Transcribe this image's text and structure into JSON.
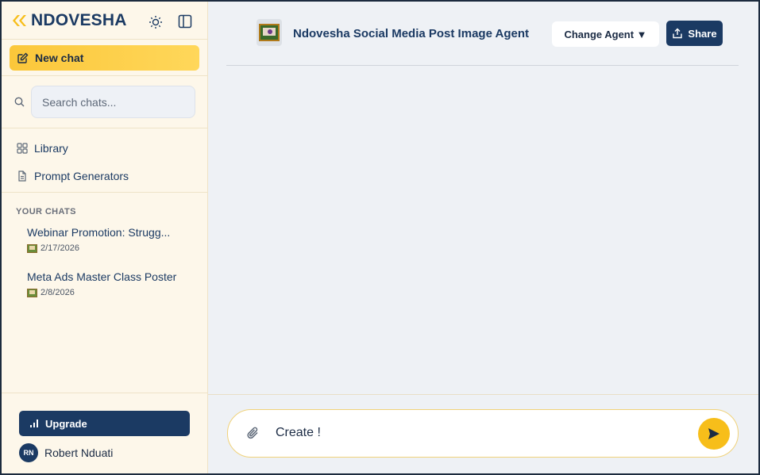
{
  "brand": {
    "name": "NDOVESHA"
  },
  "colors": {
    "primary": "#1b3a63",
    "accent": "#fbc73a",
    "sidebar_bg": "#fdf7ea",
    "main_bg": "#eef1f5"
  },
  "sidebar": {
    "new_chat_label": "New chat",
    "search_placeholder": "Search chats...",
    "nav": [
      {
        "label": "Library",
        "icon": "grid-icon"
      },
      {
        "label": "Prompt Generators",
        "icon": "document-icon"
      }
    ],
    "section_title": "YOUR CHATS",
    "chats": [
      {
        "title": "Webinar Promotion: Strugg...",
        "date": "2/17/2026"
      },
      {
        "title": "Meta Ads Master Class Poster",
        "date": "2/8/2026"
      }
    ],
    "upgrade_label": "Upgrade",
    "user": {
      "initials": "RN",
      "name": "Robert Nduati"
    }
  },
  "header": {
    "agent_title": "Ndovesha Social Media Post Image Agent",
    "change_agent_label": "Change Agent ▼",
    "share_label": "Share"
  },
  "composer": {
    "value": "Create !"
  }
}
